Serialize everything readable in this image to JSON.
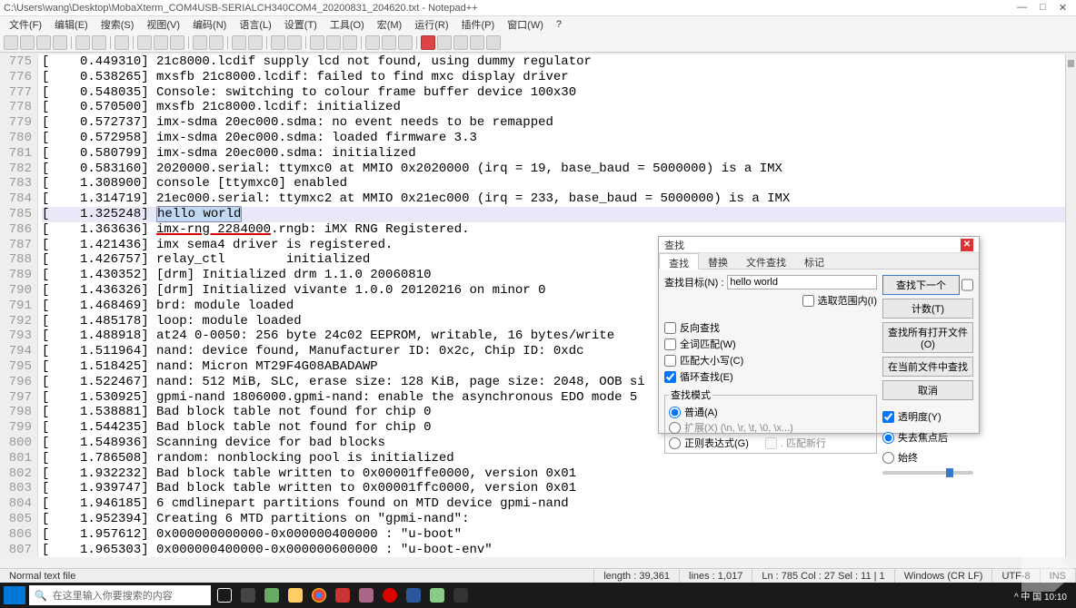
{
  "window": {
    "title": "C:\\Users\\wang\\Desktop\\MobaXterm_COM4USB-SERIALCH340COM4_20200831_204620.txt - Notepad++"
  },
  "menu": {
    "items": [
      "文件(F)",
      "编辑(E)",
      "搜索(S)",
      "视图(V)",
      "编码(N)",
      "语言(L)",
      "设置(T)",
      "工具(O)",
      "宏(M)",
      "运行(R)",
      "插件(P)",
      "窗口(W)",
      "?"
    ]
  },
  "tabs": {
    "active": "MobaXterm_COM4USB-SERIALCH340COM4_20200831_204620.txt"
  },
  "search_text": "hello world",
  "lines": [
    {
      "n": 775,
      "t": "[    0.449310] 21c8000.lcdif supply lcd not found, using dummy regulator"
    },
    {
      "n": 776,
      "t": "[    0.538265] mxsfb 21c8000.lcdif: failed to find mxc display driver"
    },
    {
      "n": 777,
      "t": "[    0.548035] Console: switching to colour frame buffer device 100x30"
    },
    {
      "n": 778,
      "t": "[    0.570500] mxsfb 21c8000.lcdif: initialized"
    },
    {
      "n": 779,
      "t": "[    0.572737] imx-sdma 20ec000.sdma: no event needs to be remapped"
    },
    {
      "n": 780,
      "t": "[    0.572958] imx-sdma 20ec000.sdma: loaded firmware 3.3"
    },
    {
      "n": 781,
      "t": "[    0.580799] imx-sdma 20ec000.sdma: initialized"
    },
    {
      "n": 782,
      "t": "[    0.583160] 2020000.serial: ttymxc0 at MMIO 0x2020000 (irq = 19, base_baud = 5000000) is a IMX"
    },
    {
      "n": 783,
      "t": "[    1.308900] console [ttymxc0] enabled"
    },
    {
      "n": 784,
      "t": "[    1.314719] 21ec000.serial: ttymxc2 at MMIO 0x21ec000 (irq = 233, base_baud = 5000000) is a IMX"
    },
    {
      "n": 785,
      "pre": "[    1.325248] ",
      "hi": "hello world",
      "hl": true
    },
    {
      "n": 786,
      "t_pre": "[    1.363636] ",
      "t_und": "imx-rng 2284000",
      "t_post": ".rngb: iMX RNG Registered."
    },
    {
      "n": 787,
      "t": "[    1.421436] imx sema4 driver is registered."
    },
    {
      "n": 788,
      "t": "[    1.426757] relay_ctl        initialized"
    },
    {
      "n": 789,
      "t": "[    1.430352] [drm] Initialized drm 1.1.0 20060810"
    },
    {
      "n": 790,
      "t": "[    1.436326] [drm] Initialized vivante 1.0.0 20120216 on minor 0"
    },
    {
      "n": 791,
      "t": "[    1.468469] brd: module loaded"
    },
    {
      "n": 792,
      "t": "[    1.485178] loop: module loaded"
    },
    {
      "n": 793,
      "t": "[    1.488918] at24 0-0050: 256 byte 24c02 EEPROM, writable, 16 bytes/write"
    },
    {
      "n": 794,
      "t": "[    1.511964] nand: device found, Manufacturer ID: 0x2c, Chip ID: 0xdc"
    },
    {
      "n": 795,
      "t": "[    1.518425] nand: Micron MT29F4G08ABADAWP"
    },
    {
      "n": 796,
      "t": "[    1.522467] nand: 512 MiB, SLC, erase size: 128 KiB, page size: 2048, OOB si"
    },
    {
      "n": 797,
      "t": "[    1.530925] gpmi-nand 1806000.gpmi-nand: enable the asynchronous EDO mode 5"
    },
    {
      "n": 798,
      "t": "[    1.538881] Bad block table not found for chip 0"
    },
    {
      "n": 799,
      "t": "[    1.544235] Bad block table not found for chip 0"
    },
    {
      "n": 800,
      "t": "[    1.548936] Scanning device for bad blocks"
    },
    {
      "n": 801,
      "t": "[    1.786508] random: nonblocking pool is initialized"
    },
    {
      "n": 802,
      "t": "[    1.932232] Bad block table written to 0x00001ffe0000, version 0x01"
    },
    {
      "n": 803,
      "t": "[    1.939747] Bad block table written to 0x00001ffc0000, version 0x01"
    },
    {
      "n": 804,
      "t": "[    1.946185] 6 cmdlinepart partitions found on MTD device gpmi-nand"
    },
    {
      "n": 805,
      "t": "[    1.952394] Creating 6 MTD partitions on \"gpmi-nand\":"
    },
    {
      "n": 806,
      "t": "[    1.957612] 0x000000000000-0x000000400000 : \"u-boot\""
    },
    {
      "n": 807,
      "t": "[    1.965303] 0x000000400000-0x000000600000 : \"u-boot-env\""
    }
  ],
  "dialog": {
    "title": "查找",
    "tabs": [
      "查找",
      "替换",
      "文件查找",
      "标记"
    ],
    "find_label": "查找目标(N) :",
    "find_value": "hello world",
    "btn_find_next": "查找下一个",
    "btn_count": "计数(T)",
    "btn_find_all_open": "查找所有打开文件(O)",
    "btn_find_all_current": "在当前文件中查找",
    "btn_cancel": "取消",
    "chk_selection": "选取范围内(I)",
    "chk_backward": "反向查找",
    "chk_whole_word": "全词匹配(W)",
    "chk_match_case": "匹配大小写(C)",
    "chk_wrap": "循环查找(E)",
    "grp_mode": "查找模式",
    "radio_normal": "普通(A)",
    "radio_extended": "扩展(X) (\\n, \\r, \\t, \\0, \\x...)",
    "radio_regex": "正则表达式(G)",
    "chk_dot_newline": ". 匹配新行",
    "chk_transparent": "透明度(Y)",
    "radio_on_lose_focus": "失去焦点后",
    "radio_always": "始终"
  },
  "status": {
    "type": "Normal text file",
    "length": "length : 39,361",
    "lines": "lines : 1,017",
    "pos": "Ln : 785    Col : 27    Sel : 11 | 1",
    "eol": "Windows (CR LF)",
    "enc": "UTF-8",
    "ins": "INS"
  },
  "taskbar": {
    "search_placeholder": "在这里输入你要搜索的内容",
    "tray_text": "^ 中 国 10:10"
  }
}
